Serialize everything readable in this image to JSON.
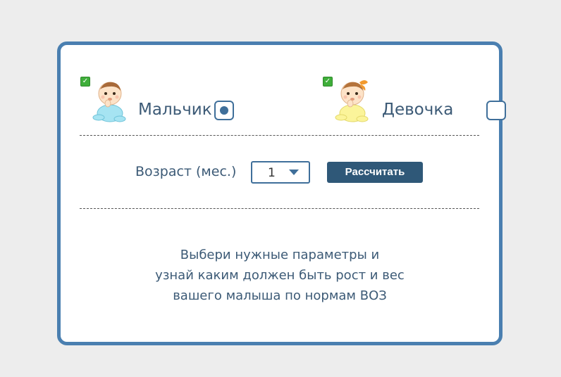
{
  "gender": {
    "boy": {
      "label": "Мальчик",
      "selected": true,
      "icon": "baby-boy-icon"
    },
    "girl": {
      "label": "Девочка",
      "selected": false,
      "icon": "baby-girl-icon"
    }
  },
  "age": {
    "label": "Возраст (мес.)",
    "selected_value": "1"
  },
  "calculate_button": {
    "label": "Рассчитать"
  },
  "info_text": {
    "lines": [
      "Выбери нужные параметры и",
      "узнай каким должен быть рост и вес",
      "вашего малыша по нормам ВОЗ"
    ]
  },
  "colors": {
    "accent": "#4a7fb0",
    "button": "#2f5878",
    "text": "#3c5a76",
    "background": "#ededed",
    "check_badge": "#3fae3a"
  }
}
